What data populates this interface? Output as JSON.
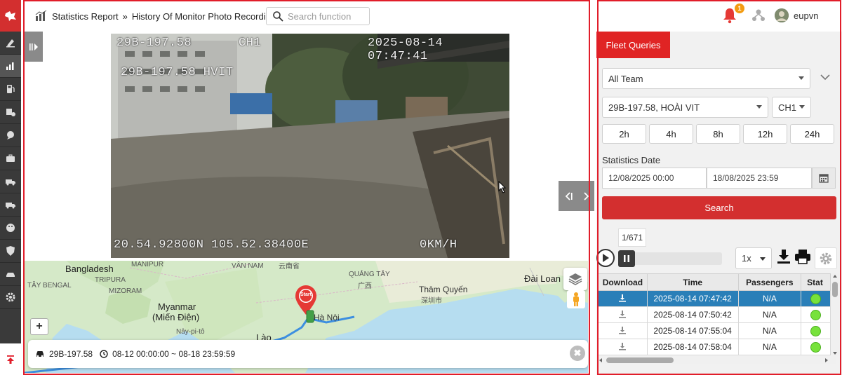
{
  "breadcrumb": {
    "section": "Statistics Report",
    "separator": "»",
    "page": "History Of Monitor Photo Recording"
  },
  "search": {
    "placeholder": "Search function"
  },
  "video": {
    "plate_overlay": "29B-197.58",
    "plate_overlay_2": "29B-197.58 HVIT",
    "channel_overlay": "CH1",
    "timestamp_overlay": "2025-08-14 07:47:41",
    "coords_overlay": "20.54.92800N 105.52.38400E",
    "speed_overlay": "0KM/H"
  },
  "map": {
    "labels": [
      "Bangladesh",
      "TÂY BENGAL",
      "TRIPURA",
      "MIZORAM",
      "MANIPUR",
      "Myanmar",
      "(Miến Điện)",
      "Nây-pi-tô",
      "VÂN NAM",
      "云南省",
      "QUẢNG TÂY",
      "广西",
      "Thâm Quyến",
      "深圳市",
      "Đài Loan",
      "Hà Nội",
      "Lào"
    ],
    "start_marker": "Start",
    "zoom_in": "+"
  },
  "info_bar": {
    "plate": "29B-197.58",
    "range": "08-12 00:00:00 ~ 08-18 23:59:59",
    "close": "✖"
  },
  "user": {
    "notifications": "1",
    "name": "eupvn"
  },
  "panel": {
    "tab": "Fleet Queries",
    "team": "All Team",
    "vehicle": "29B-197.58, HOÀI VIT",
    "channel": "CH1",
    "hours": [
      "2h",
      "4h",
      "8h",
      "12h",
      "24h"
    ],
    "date_label": "Statistics Date",
    "date_from": "12/08/2025 00:00",
    "date_to": "18/08/2025 23:59",
    "search_button": "Search",
    "pager": "1/671",
    "speed": "1x"
  },
  "table": {
    "columns": [
      "Download",
      "Time",
      "Passengers",
      "Stat"
    ],
    "rows": [
      {
        "time": "2025-08-14 07:47:42",
        "passengers": "N/A"
      },
      {
        "time": "2025-08-14 07:50:42",
        "passengers": "N/A"
      },
      {
        "time": "2025-08-14 07:55:04",
        "passengers": "N/A"
      },
      {
        "time": "2025-08-14 07:58:04",
        "passengers": "N/A"
      }
    ]
  },
  "colors": {
    "accent": "#e02424",
    "selected_row": "#2a7fb8",
    "status_ok": "#77e23b"
  }
}
